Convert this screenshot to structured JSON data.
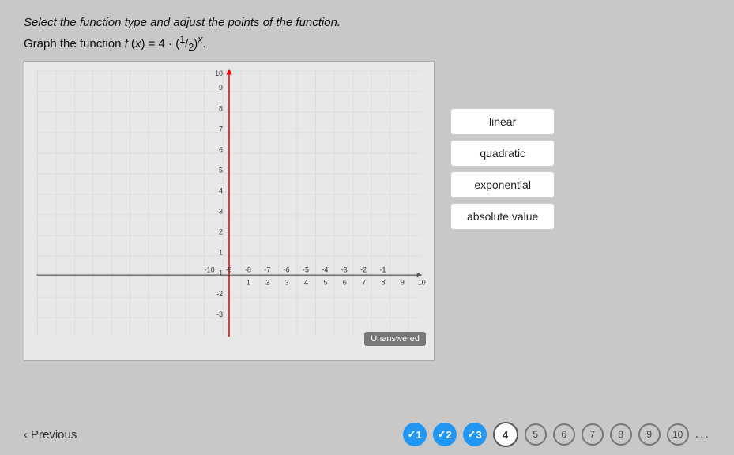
{
  "instructions": "Select the function type and adjust the points of the function.",
  "function_label": "Graph the function",
  "function_expression": "f (x) = 4 · (1/2)^x",
  "function_expression_display": "f (x) = 4 · (½)ˣ",
  "unanswered": "Unanswered",
  "function_types": [
    "linear",
    "quadratic",
    "exponential",
    "absolute value"
  ],
  "nav": {
    "previous": "Previous"
  },
  "questions": [
    {
      "num": "1",
      "state": "completed"
    },
    {
      "num": "2",
      "state": "completed"
    },
    {
      "num": "3",
      "state": "completed"
    },
    {
      "num": "4",
      "state": "current"
    },
    {
      "num": "5",
      "state": "empty"
    },
    {
      "num": "6",
      "state": "empty"
    },
    {
      "num": "7",
      "state": "empty"
    },
    {
      "num": "8",
      "state": "empty"
    },
    {
      "num": "9",
      "state": "empty"
    },
    {
      "num": "10",
      "state": "empty"
    }
  ],
  "graph": {
    "x_min": -10,
    "x_max": 10,
    "y_min": -3,
    "y_max": 10
  }
}
